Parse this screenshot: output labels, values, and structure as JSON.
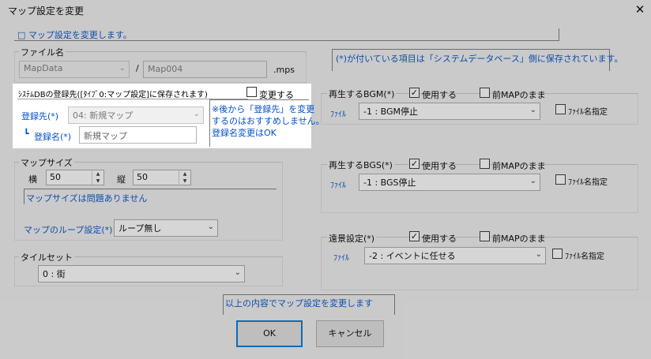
{
  "window": {
    "title": "マップ設定を変更",
    "close_glyph": "✕"
  },
  "info": {
    "message": "□ マップ設定を変更します。"
  },
  "file_name": {
    "label": "ファイル名",
    "folder": "MapData",
    "separator": "/",
    "name": "Map004",
    "extension": ".mps"
  },
  "sysdb": {
    "title": "ｼｽﾃﾑDBの登録先([ﾀｲﾌﾟ0:マップ設定]に保存されます)",
    "change_label": "変更する",
    "change_checked": false,
    "dest_label": "登録先(*)",
    "dest_value": "04: 新規マップ",
    "regname_prefix": "┗",
    "regname_label": "登録名(*)",
    "regname_value": "新規マップ",
    "note_line1": "※後から「登録先」を変更",
    "note_line2": "するのはおすすめしません。",
    "note_line3": "登録名変更はOK"
  },
  "mapsize": {
    "label": "マップサイズ",
    "width_label": "横",
    "width_value": "50",
    "height_label": "縦",
    "height_value": "50",
    "status": "マップサイズは問題ありません",
    "loop_label": "マップのループ設定(*)",
    "loop_value": "ループ無し"
  },
  "tileset": {
    "label": "タイルセット",
    "value": "0 : 街"
  },
  "db_note": "(*)が付いている項目は「システムデータベース」側に保存されています。",
  "bgm": {
    "label": "再生するBGM(*)",
    "use_label": "使用する",
    "use_checked": true,
    "keep_label": "前MAPのまま",
    "keep_checked": false,
    "file_label": "ﾌｧｲﾙ",
    "file_value": "-1 : BGM停止",
    "spec_label": "ﾌｧｲﾙ名指定",
    "spec_checked": false
  },
  "bgs": {
    "label": "再生するBGS(*)",
    "use_label": "使用する",
    "use_checked": true,
    "keep_label": "前MAPのまま",
    "keep_checked": false,
    "file_label": "ﾌｧｲﾙ",
    "file_value": "-1 : BGS停止",
    "spec_label": "ﾌｧｲﾙ名指定",
    "spec_checked": false
  },
  "parallax": {
    "label": "遠景設定(*)",
    "use_label": "使用する",
    "use_checked": true,
    "keep_label": "前MAPのまま",
    "keep_checked": false,
    "file_label": "ﾌｧｲﾙ",
    "file_value": "-2 : イベントに任せる",
    "spec_label": "ﾌｧｲﾙ名指定",
    "spec_checked": false
  },
  "footer": {
    "status": "以上の内容でマップ設定を変更します",
    "ok_label": "OK",
    "cancel_label": "キャンセル"
  }
}
